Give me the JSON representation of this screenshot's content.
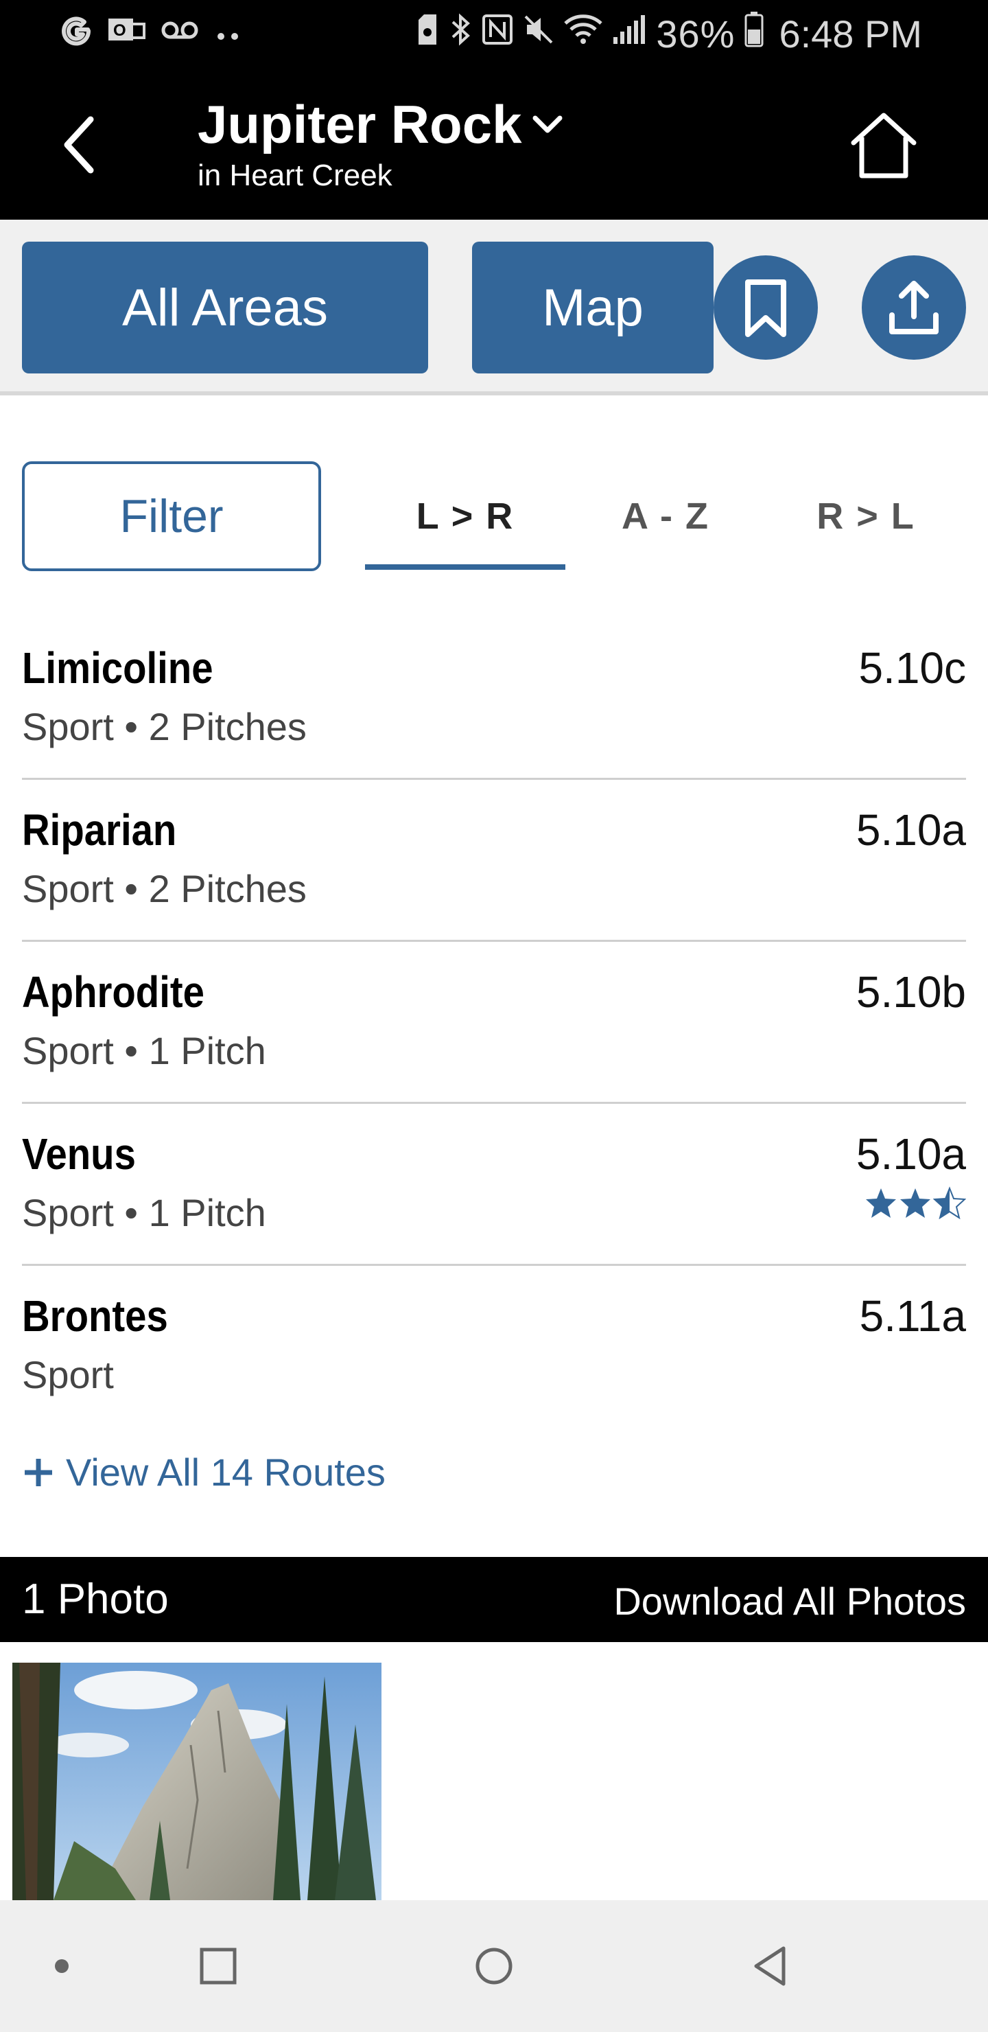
{
  "status_bar": {
    "battery_percent": "36%",
    "time": "6:48 PM",
    "left_icons": [
      "google-icon",
      "mail-icon",
      "voicemail-icon",
      "more-dots-icon"
    ],
    "right_icons": [
      "save-icon",
      "bluetooth-icon",
      "nfc-icon",
      "mute-icon",
      "wifi-icon",
      "signal-icon",
      "battery-icon"
    ]
  },
  "header": {
    "title": "Jupiter Rock",
    "subtitle": "in Heart Creek"
  },
  "toolbar": {
    "all_areas_label": "All Areas",
    "map_label": "Map"
  },
  "sort": {
    "filter_label": "Filter",
    "tabs": [
      {
        "label": "L > R",
        "active": true
      },
      {
        "label": "A - Z",
        "active": false
      },
      {
        "label": "R > L",
        "active": false
      }
    ]
  },
  "routes": [
    {
      "name": "Limicoline",
      "meta": "Sport • 2 Pitches",
      "grade": "5.10c"
    },
    {
      "name": "Riparian",
      "meta": "Sport • 2 Pitches",
      "grade": "5.10a"
    },
    {
      "name": "Aphrodite",
      "meta": "Sport • 1 Pitch",
      "grade": "5.10b"
    },
    {
      "name": "Venus",
      "meta": "Sport • 1 Pitch",
      "grade": "5.10a",
      "rating": 2.5,
      "rating_max": 3
    },
    {
      "name": "Brontes",
      "meta": "Sport",
      "grade": "5.11a"
    }
  ],
  "view_all_label": "View All 14 Routes",
  "photos": {
    "count_label": "1 Photo",
    "download_label": "Download All Photos"
  },
  "colors": {
    "accent": "#336699",
    "header_bg": "#000000",
    "toolbar_bg": "#f0f0f0"
  }
}
